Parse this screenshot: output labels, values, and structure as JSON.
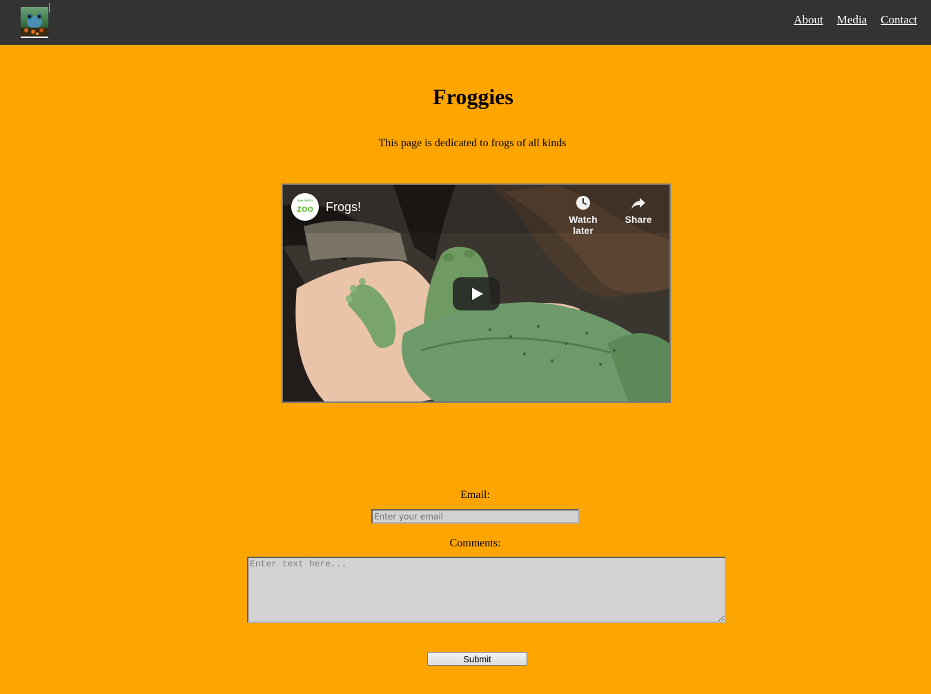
{
  "nav": {
    "logo_alt": "frog logo",
    "links": [
      "About",
      "Media",
      "Contact"
    ]
  },
  "main": {
    "title": "Froggies",
    "subtitle": "This page is dedicated to frogs of all kinds"
  },
  "video": {
    "title": "Frogs!",
    "channel": "San Diego Zoo",
    "watch_later_label": "Watch later",
    "share_label": "Share"
  },
  "form": {
    "email_label": "Email:",
    "email_placeholder": "Enter your email",
    "comments_label": "Comments:",
    "comments_placeholder": "Enter text here...",
    "submit_label": "Submit"
  },
  "colors": {
    "page_background": "#ffa500",
    "navbar_background": "#333333",
    "input_background": "#d3d3d3"
  }
}
